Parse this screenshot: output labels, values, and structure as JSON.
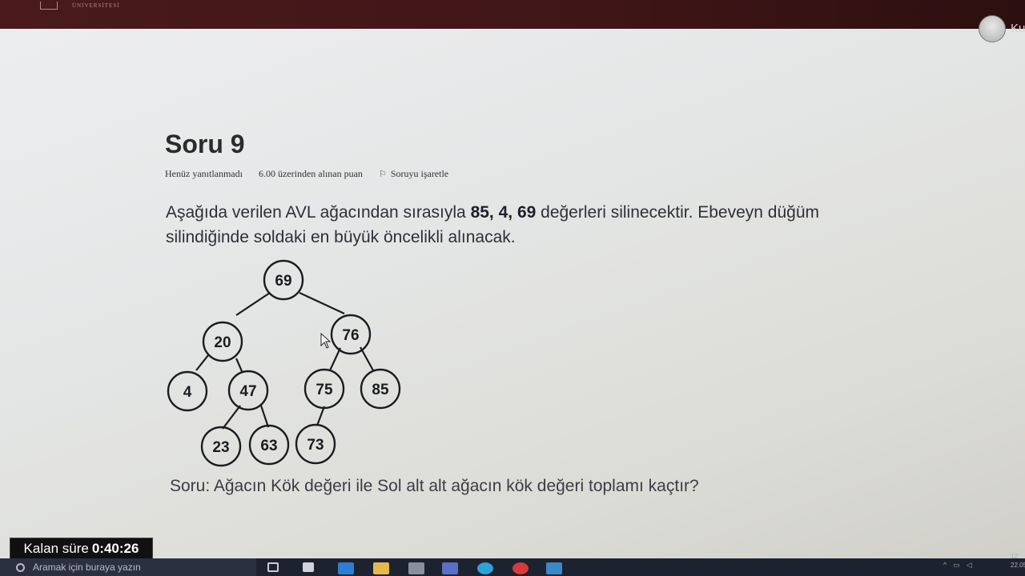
{
  "header": {
    "brand_text": "ÜNİVERSİTESİ",
    "user_name": "Ku"
  },
  "question": {
    "title": "Soru 9",
    "status": "Henüz yanıtlanmadı",
    "points": "6.00 üzerinden alınan puan",
    "flag_label": "Soruyu işaretle",
    "text_before": "Aşağıda verilen AVL ağacından sırasıyla ",
    "text_bold": "85, 4, 69",
    "text_after": " değerleri silinecektir. Ebeveyn düğüm silindiğinde soldaki en büyük öncelikli alınacak.",
    "prompt": "Soru: Ağacın Kök değeri ile Sol alt alt ağacın kök değeri toplamı kaçtır?"
  },
  "tree": {
    "nodes": [
      "69",
      "20",
      "76",
      "4",
      "47",
      "75",
      "85",
      "23",
      "63",
      "73"
    ]
  },
  "timer": {
    "label": "Kalan süre",
    "value": "0:40:26"
  },
  "taskbar": {
    "search_placeholder": "Aramak için buraya yazın",
    "clock_time": "12:",
    "clock_date": "22.05"
  }
}
